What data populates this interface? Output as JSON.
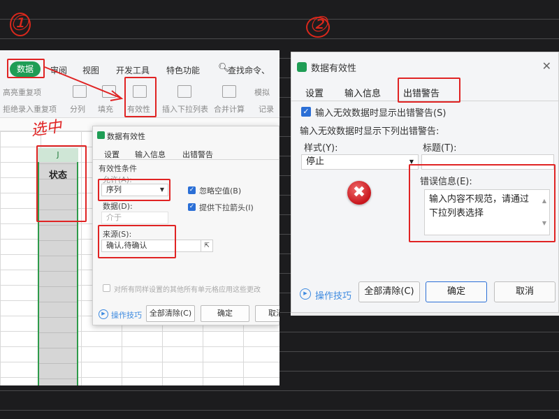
{
  "annotations": {
    "step1": "①",
    "step2": "②",
    "selected_note": "选中"
  },
  "panel1": {
    "menu": {
      "data_tab": "数据",
      "review": "审阅",
      "view": "视图",
      "developer": "开发工具",
      "features": "特色功能",
      "search": "查找命令、"
    },
    "toolbar": {
      "reject_dup": "拒绝录入重复项",
      "highlight_dup": "高亮重复项",
      "split": "分列",
      "fill": "填充",
      "validity": "有效性",
      "dropdown": "插入下拉列表",
      "merge_calc": "合并计算",
      "simulate": "模拟",
      "record": "记录"
    },
    "column_header": "J",
    "status_label": "状态",
    "dialog": {
      "title": "数据有效性",
      "tabs": [
        "设置",
        "输入信息",
        "出错警告"
      ],
      "conditions_label": "有效性条件",
      "allow_label": "允许(A):",
      "allow_value": "序列",
      "ignore_blank": "忽略空值(B)",
      "dropdown_arrow": "提供下拉箭头(I)",
      "data_label": "数据(D):",
      "data_value": "介于",
      "source_label": "来源(S):",
      "source_value": "确认,待确认",
      "apply_all": "对所有同样设置的其他所有单元格应用这些更改",
      "tips": "操作技巧",
      "clear_all": "全部清除(C)",
      "ok": "确定",
      "cancel": "取消"
    }
  },
  "panel2": {
    "title": "数据有效性",
    "tabs": [
      "设置",
      "输入信息",
      "出错警告"
    ],
    "show_error_check": "输入无效数据时显示出错警告(S)",
    "section_label": "输入无效数据时显示下列出错警告:",
    "style_label": "样式(Y):",
    "style_value": "停止",
    "title_label": "标题(T):",
    "error_label": "错误信息(E):",
    "error_message": "输入内容不规范，请通过下拉列表选择",
    "tips": "操作技巧",
    "clear_all": "全部清除(C)",
    "ok": "确定",
    "cancel": "取消"
  },
  "colors": {
    "annotation_red": "#e02323",
    "accent_green": "#1f9d55",
    "checkbox_blue": "#2b6fd6"
  }
}
